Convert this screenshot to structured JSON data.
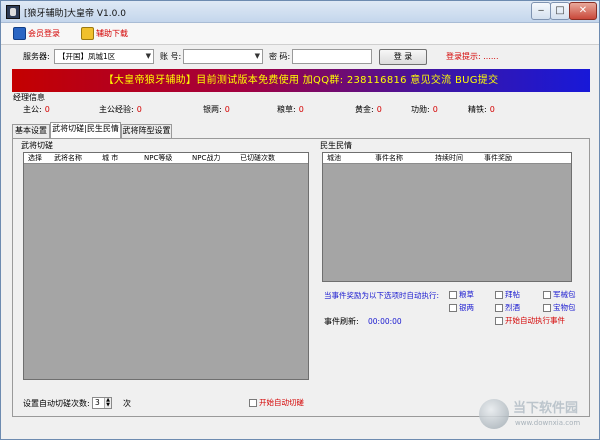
{
  "window": {
    "title": "[狼牙辅助]大皇帝 V1.0.0",
    "min_glyph": "‒",
    "max_glyph": "□",
    "close_glyph": "✕"
  },
  "menu": {
    "member_login": "会员登录",
    "member_icon": "member-card-icon",
    "download": "辅助下载",
    "download_icon": "download-icon"
  },
  "login": {
    "server_label": "服务器:",
    "server_value": "【开国】凤城1区",
    "account_label": "账  号:",
    "account_value": "",
    "password_label": "密  码:",
    "password_value": "",
    "login_button": "登  录",
    "hint": "登录提示: ......"
  },
  "banner": {
    "text": "【大皇帝狼牙辅助】目前测试版本免费使用    加QQ群: 238116816 意见交流 BUG提交"
  },
  "manager": {
    "title": "经理信息",
    "stats": [
      {
        "label": "主公:",
        "value": "0"
      },
      {
        "label": "主公经验:",
        "value": "0"
      },
      {
        "label": "银两:",
        "value": "0"
      },
      {
        "label": "粮草:",
        "value": "0"
      },
      {
        "label": "黄金:",
        "value": "0"
      },
      {
        "label": "功勋:",
        "value": "0"
      },
      {
        "label": "精铁:",
        "value": "0"
      }
    ]
  },
  "tabs": [
    {
      "label": "基本设置",
      "active": false
    },
    {
      "label": "武将切磋|民生民情",
      "active": true
    },
    {
      "label": "武将阵型设置",
      "active": false
    }
  ],
  "duel": {
    "group_title": "武将切磋",
    "columns": [
      "选择",
      "武将名称",
      "城 市",
      "NPC等级",
      "NPC战力",
      "已切磋次数"
    ],
    "auto_count_label": "设置自动切磋次数:",
    "auto_count_value": "3",
    "auto_count_unit": "次",
    "auto_start_label": "开始自动切磋",
    "spin_up": "▲",
    "spin_down": "▼"
  },
  "livelihood": {
    "group_title": "民生民情",
    "columns": [
      "城池",
      "事件名称",
      "持续时间",
      "事件奖励"
    ],
    "reward_hint": "当事件奖励为以下选项时自动执行:",
    "options": [
      {
        "label": "粮草",
        "checked": false
      },
      {
        "label": "拜帖",
        "checked": false
      },
      {
        "label": "军械包",
        "checked": false
      },
      {
        "label": "银两",
        "checked": false
      },
      {
        "label": "烈酒",
        "checked": false
      },
      {
        "label": "宝物包",
        "checked": false
      }
    ],
    "refresh_label": "事件刷新:",
    "refresh_value": "00:00:00",
    "auto_exec_label": "开始自动执行事件"
  },
  "watermark": {
    "text": "当下软件园",
    "url": "www.downxia.com"
  }
}
